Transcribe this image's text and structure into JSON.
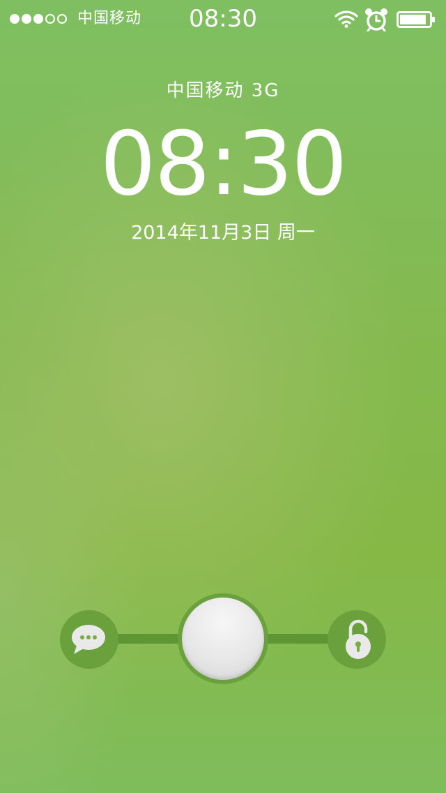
{
  "status_bar": {
    "signal_dots_filled": 3,
    "signal_dots_total": 5,
    "carrier": "中国移动",
    "time": "08:30",
    "icons": [
      "wifi-icon",
      "alarm-icon",
      "battery-icon"
    ],
    "battery_level": 0.9
  },
  "lock_screen": {
    "network_label": "中国移动  3G",
    "time": "08:30",
    "date": "2014年11月3日  周一"
  },
  "slider": {
    "left_icon": "message-bubble-icon",
    "right_icon": "unlock-icon",
    "knob_color": "#e8e8e8"
  },
  "colors": {
    "background": "#84b94e",
    "track": "#5e9634",
    "circle": "#6aa13c",
    "text": "#ffffff"
  }
}
